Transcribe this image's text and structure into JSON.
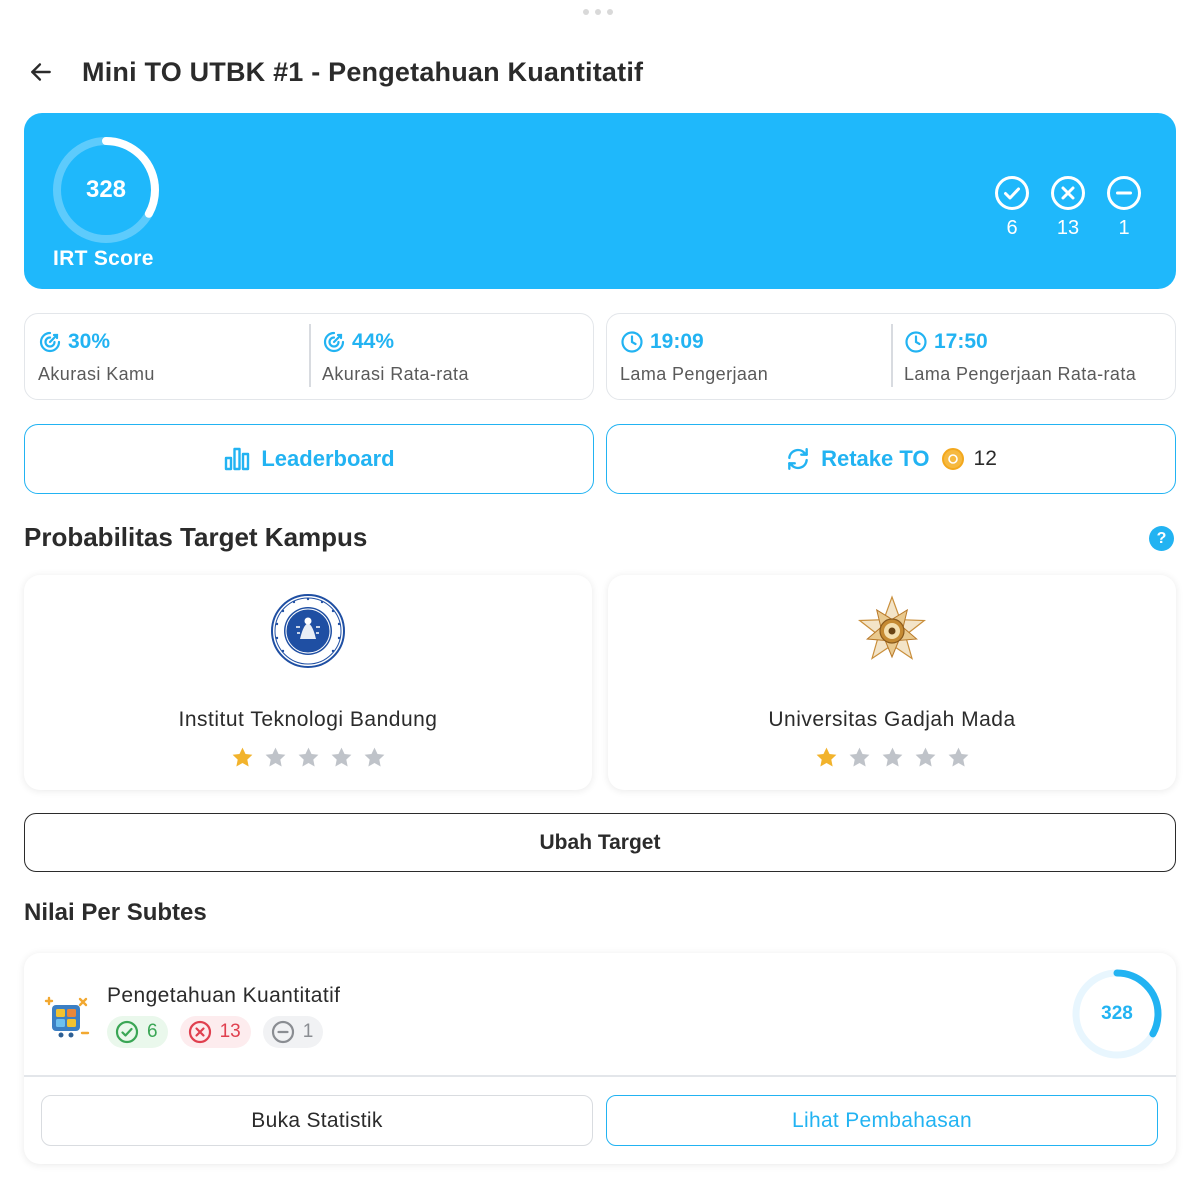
{
  "header": {
    "title": "Mini TO UTBK #1 - Pengetahuan Kuantitatif"
  },
  "score": {
    "value": "328",
    "label": "IRT Score",
    "ring_progress": 0.33,
    "correct": "6",
    "wrong": "13",
    "skipped": "1"
  },
  "accuracy": {
    "yours_value": "30%",
    "yours_label": "Akurasi Kamu",
    "avg_value": "44%",
    "avg_label": "Akurasi Rata-rata"
  },
  "duration": {
    "yours_value": "19:09",
    "yours_label": "Lama Pengerjaan",
    "avg_value": "17:50",
    "avg_label": "Lama Pengerjaan Rata-rata"
  },
  "actions": {
    "leaderboard_label": "Leaderboard",
    "retake_label": "Retake TO",
    "retake_cost": "12"
  },
  "campus_section": {
    "title": "Probabilitas Target Kampus",
    "help_symbol": "?",
    "campuses": [
      {
        "name": "Institut Teknologi Bandung",
        "rating": 1,
        "max_rating": 5
      },
      {
        "name": "Universitas Gadjah Mada",
        "rating": 1,
        "max_rating": 5
      }
    ],
    "change_button": "Ubah Target"
  },
  "subtest_section": {
    "title": "Nilai Per Subtes",
    "subtests": [
      {
        "name": "Pengetahuan Kuantitatif",
        "correct": "6",
        "wrong": "13",
        "skipped": "1",
        "score": "328",
        "ring_progress": 0.33,
        "stats_button": "Buka Statistik",
        "discussion_button": "Lihat Pembahasan"
      }
    ]
  },
  "colors": {
    "primary": "#1fb8fb",
    "accent": "#22b3f2",
    "star_filled": "#f2b32c",
    "star_empty": "#bfc3c9",
    "correct": "#3aa655",
    "wrong": "#e0404f",
    "skip": "#8a8d92"
  },
  "icons": {
    "back": "arrow-left-icon",
    "correct": "check-circle-icon",
    "wrong": "x-circle-icon",
    "skipped": "minus-circle-icon",
    "accuracy": "target-icon",
    "duration": "clock-icon",
    "leaderboard": "bar-chart-icon",
    "retake": "refresh-icon",
    "coin": "coin-icon",
    "help": "help-icon",
    "star": "star-icon"
  }
}
